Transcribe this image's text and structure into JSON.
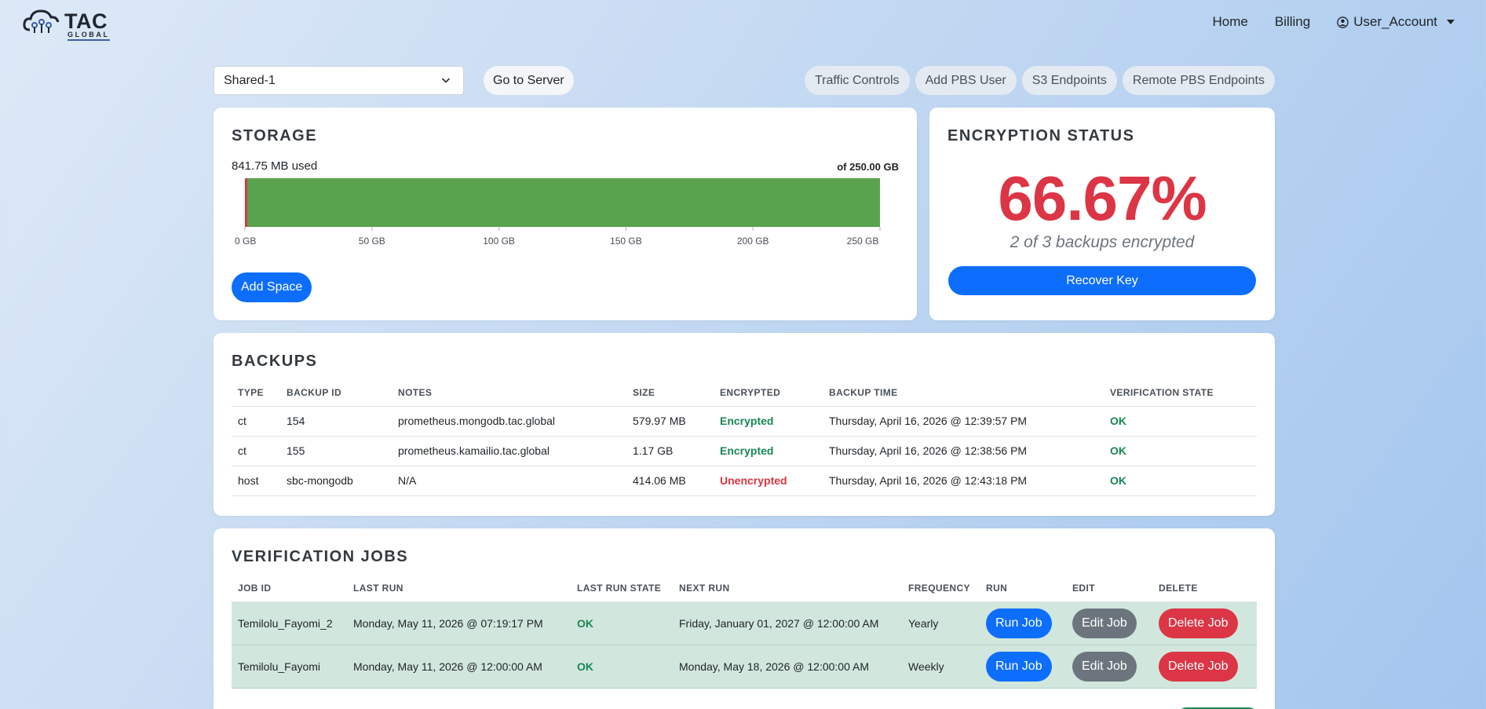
{
  "brand": {
    "name": "TAC",
    "sub": "GLOBAL"
  },
  "nav": {
    "home": "Home",
    "billing": "Billing",
    "account": "User_Account"
  },
  "controls": {
    "server": "Shared-1",
    "go_to_server": "Go to Server",
    "pills": [
      "Traffic Controls",
      "Add PBS User",
      "S3 Endpoints",
      "Remote PBS Endpoints"
    ]
  },
  "storage": {
    "title": "STORAGE",
    "used_label": "841.75 MB used",
    "of_label": "of 250.00 GB",
    "used_fraction": 0.0033,
    "ticks": [
      "0 GB",
      "50 GB",
      "100 GB",
      "150 GB",
      "200 GB",
      "250 GB"
    ],
    "add_space": "Add Space",
    "colors": {
      "free": "#5aa34e",
      "used": "#dc3545"
    }
  },
  "encryption": {
    "title": "ENCRYPTION STATUS",
    "percent": "66.67%",
    "subtitle": "2 of 3 backups encrypted",
    "recover_key": "Recover Key"
  },
  "backups": {
    "title": "BACKUPS",
    "columns": [
      "TYPE",
      "BACKUP ID",
      "NOTES",
      "SIZE",
      "ENCRYPTED",
      "BACKUP TIME",
      "VERIFICATION STATE"
    ],
    "rows": [
      {
        "type": "ct",
        "id": "154",
        "notes": "prometheus.mongodb.tac.global",
        "size": "579.97 MB",
        "encrypted": "Encrypted",
        "time": "Thursday, April 16, 2026 @ 12:39:57 PM",
        "state": "OK"
      },
      {
        "type": "ct",
        "id": "155",
        "notes": "prometheus.kamailio.tac.global",
        "size": "1.17 GB",
        "encrypted": "Encrypted",
        "time": "Thursday, April 16, 2026 @ 12:38:56 PM",
        "state": "OK"
      },
      {
        "type": "host",
        "id": "sbc-mongodb",
        "notes": "N/A",
        "size": "414.06 MB",
        "encrypted": "Unencrypted",
        "time": "Thursday, April 16, 2026 @ 12:43:18 PM",
        "state": "OK"
      }
    ]
  },
  "jobs": {
    "title": "VERIFICATION JOBS",
    "columns": [
      "JOB ID",
      "LAST RUN",
      "LAST RUN STATE",
      "NEXT RUN",
      "FREQUENCY",
      "RUN",
      "EDIT",
      "DELETE"
    ],
    "rows": [
      {
        "id": "Temilolu_Fayomi_2",
        "last_run": "Monday, May 11, 2026 @ 07:19:17 PM",
        "state": "OK",
        "next_run": "Friday, January 01, 2027 @ 12:00:00 AM",
        "frequency": "Yearly",
        "run": "Run Job",
        "edit": "Edit Job",
        "delete": "Delete Job"
      },
      {
        "id": "Temilolu_Fayomi",
        "last_run": "Monday, May 11, 2026 @ 12:00:00 AM",
        "state": "OK",
        "next_run": "Monday, May 18, 2026 @ 12:00:00 AM",
        "frequency": "Weekly",
        "run": "Run Job",
        "edit": "Edit Job",
        "delete": "Delete Job"
      }
    ]
  }
}
